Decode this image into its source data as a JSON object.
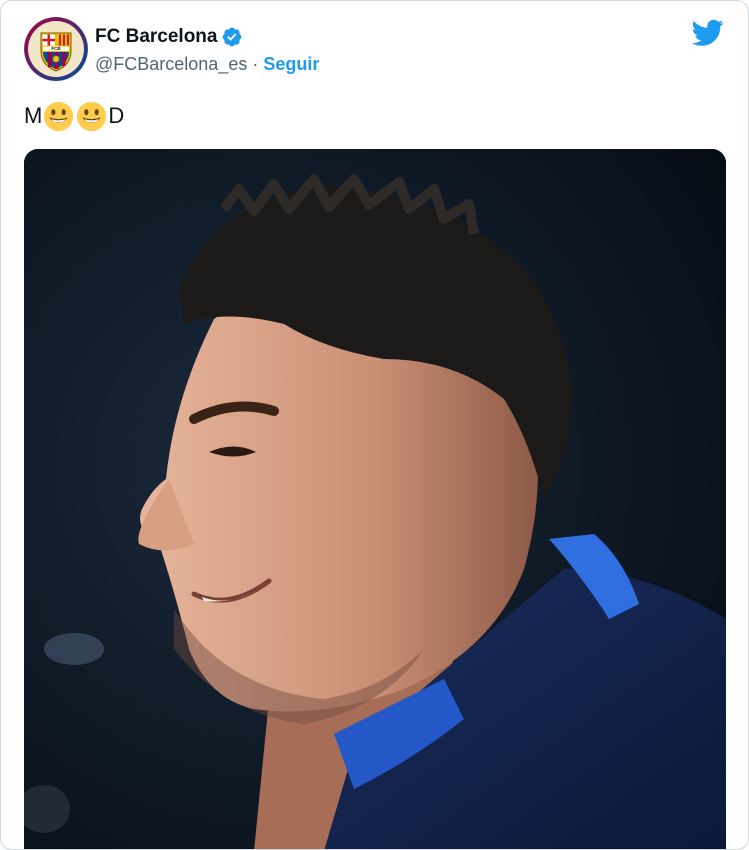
{
  "account": {
    "display_name": "FC Barcelona",
    "handle": "@FCBarcelona_es",
    "separator": "·",
    "follow_label": "Seguir",
    "verified_icon": "verified-badge-icon",
    "avatar_icon": "fc-barcelona-crest"
  },
  "tweet": {
    "text_prefix": "M",
    "text_suffix": "D",
    "emojis": [
      "smiley-emoji",
      "smiley-emoji"
    ]
  },
  "media": {
    "image": "photo-coach-smiling-profile"
  },
  "brand": {
    "twitter_blue": "#1d9bf0",
    "text_color": "#0f1419",
    "secondary_text": "#536471",
    "barca_blue": "#004d98",
    "barca_red": "#a50044"
  }
}
